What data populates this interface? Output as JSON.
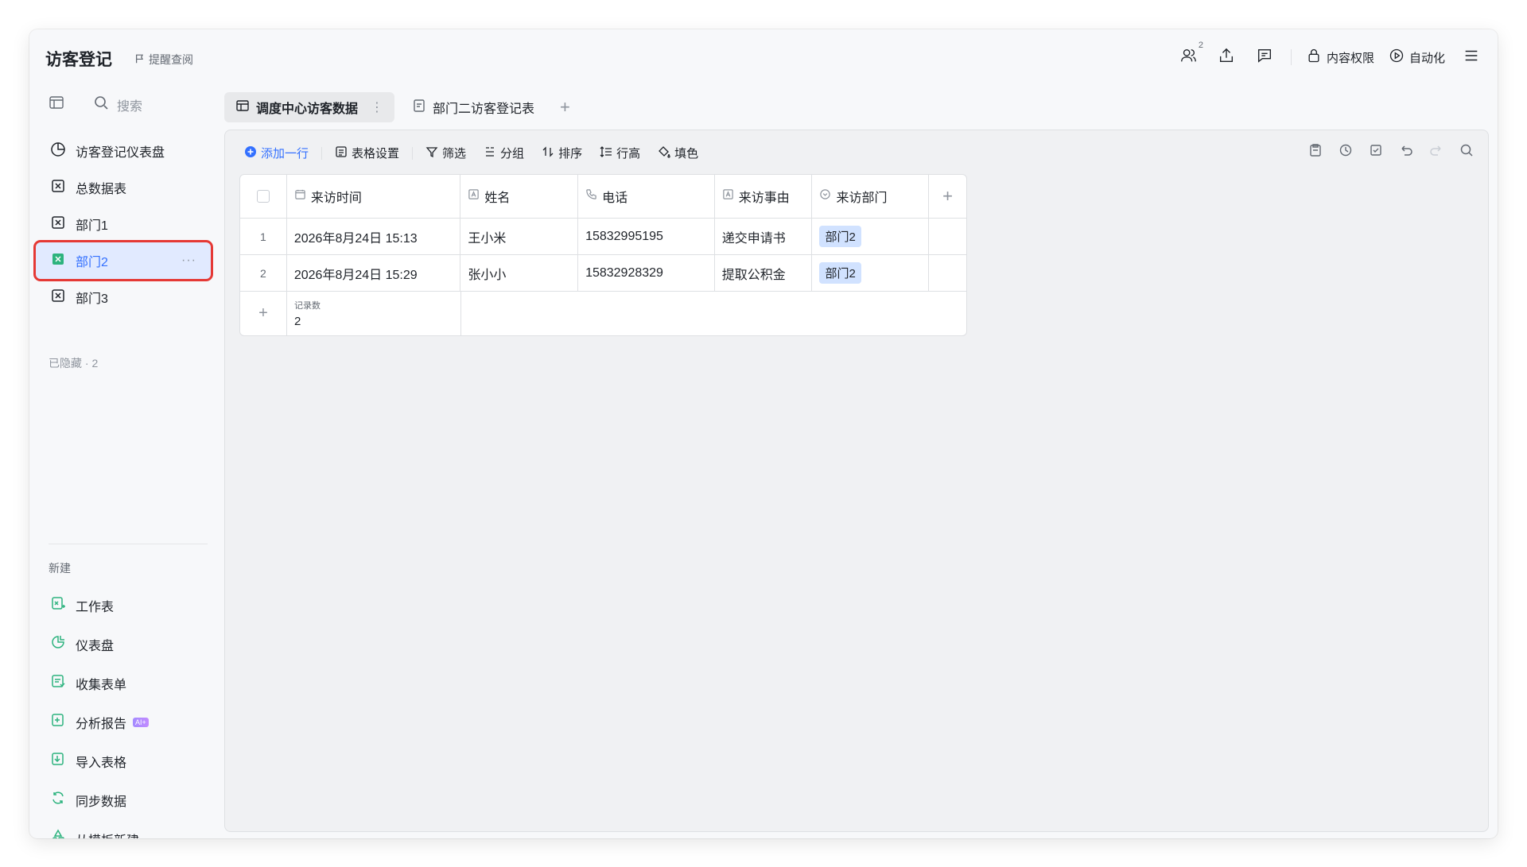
{
  "header": {
    "title": "访客登记",
    "remind": "提醒查阅",
    "collab_count": "2",
    "permission_label": "内容权限",
    "automation_label": "自动化"
  },
  "sidebar": {
    "search_placeholder": "搜索",
    "items": [
      {
        "label": "访客登记仪表盘",
        "icon": "dashboard-icon"
      },
      {
        "label": "总数据表",
        "icon": "table-icon"
      },
      {
        "label": "部门1",
        "icon": "table-icon"
      },
      {
        "label": "部门2",
        "icon": "table-icon",
        "active": true,
        "more": "···"
      },
      {
        "label": "部门3",
        "icon": "table-icon"
      }
    ],
    "hidden_label": "已隐藏 · 2",
    "new_label": "新建",
    "new_items": [
      {
        "label": "工作表",
        "icon": "new-sheet-icon"
      },
      {
        "label": "仪表盘",
        "icon": "new-dashboard-icon"
      },
      {
        "label": "收集表单",
        "icon": "form-icon"
      },
      {
        "label": "分析报告",
        "icon": "report-icon",
        "tag": "AI+"
      },
      {
        "label": "导入表格",
        "icon": "import-icon"
      },
      {
        "label": "同步数据",
        "icon": "sync-icon"
      },
      {
        "label": "从模板新建",
        "icon": "template-icon"
      }
    ]
  },
  "tabs": [
    {
      "label": "调度中心访客数据",
      "dots": "⋮"
    },
    {
      "label": "部门二访客登记表"
    }
  ],
  "tab_add": "+",
  "toolbar": {
    "add_row": "添加一行",
    "table_settings": "表格设置",
    "filter": "筛选",
    "group": "分组",
    "sort": "排序",
    "row_height": "行高",
    "fill_color": "填色"
  },
  "table": {
    "columns": [
      "来访时间",
      "姓名",
      "电话",
      "来访事由",
      "来访部门"
    ],
    "add_column": "+",
    "rows": [
      {
        "index": "1",
        "time": "2026年8月24日 15:13",
        "name": "王小米",
        "phone": "15832995195",
        "reason": "递交申请书",
        "dept": "部门2"
      },
      {
        "index": "2",
        "time": "2026年8月24日 15:29",
        "name": "张小小",
        "phone": "15832928329",
        "reason": "提取公积金",
        "dept": "部门2"
      }
    ],
    "summary_add": "+",
    "summary_label": "记录数",
    "summary_value": "2"
  },
  "colors": {
    "accent": "#3370ff",
    "active_bg": "#e1eaff",
    "highlight_border": "#e53935",
    "tag_bg": "#d1e2ff"
  }
}
